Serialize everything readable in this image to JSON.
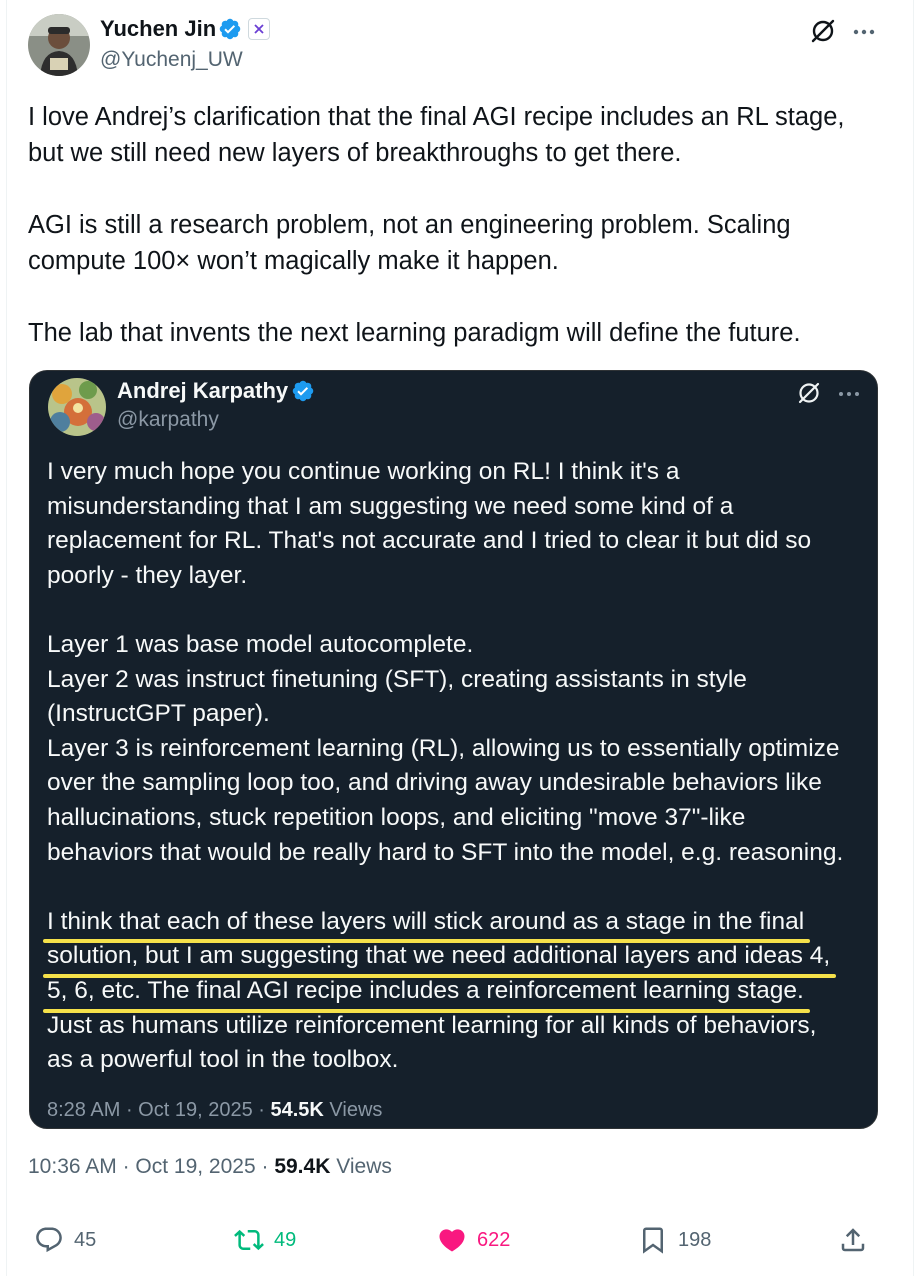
{
  "tweet": {
    "author_name": "Yuchen Jin",
    "handle": "@Yuchenj_UW",
    "text_lines": [
      "I love Andrej’s clarification that the final AGI recipe includes an RL stage,",
      "but we still need new layers of breakthroughs to get there.",
      "",
      "AGI is still a research problem, not an engineering problem. Scaling",
      "compute 100× won’t magically make it happen.",
      "",
      "The lab that invents the next learning paradigm will define the future."
    ],
    "time": "10:36 AM",
    "date": "Oct 19, 2025",
    "views_count": "59.4K",
    "views_label": "Views"
  },
  "quote": {
    "author_name": "Andrej Karpathy",
    "handle": "@karpathy",
    "p1": [
      "I very much hope you continue working on RL! I think it's a",
      "misunderstanding that I am suggesting we need some kind of a",
      "replacement for RL. That's not accurate and I tried to clear it but did so",
      "poorly - they layer."
    ],
    "p2": [
      "Layer 1 was base model autocomplete.",
      "Layer 2 was instruct finetuning (SFT), creating assistants in style",
      "(InstructGPT paper).",
      "Layer 3 is reinforcement learning (RL), allowing us to essentially optimize",
      "over the sampling loop too, and driving away undesirable behaviors like",
      "hallucinations, stuck repetition loops, and eliciting \"move 37\"-like",
      "behaviors that would be really hard to SFT into the model, e.g. reasoning."
    ],
    "p3_highlighted": [
      "I think that each of these layers will stick around as a stage in the final",
      "solution, but I am suggesting that we need additional layers and ideas 4,",
      "5, 6, etc. The final AGI recipe includes a reinforcement learning stage."
    ],
    "p3_rest": [
      "Just as humans utilize reinforcement learning for all kinds of behaviors,",
      "as a powerful tool in the toolbox."
    ],
    "time": "8:28 AM",
    "date": "Oct 19, 2025",
    "views_count": "54.5K",
    "views_label": "Views"
  },
  "actions": {
    "replies": "45",
    "reposts": "49",
    "likes": "622",
    "bookmarks": "198"
  },
  "colors": {
    "verified": "#1d9bf0",
    "repost": "#00ba7c",
    "like": "#f91880",
    "highlight": "#f5e14a",
    "quote_bg": "#15202b"
  }
}
